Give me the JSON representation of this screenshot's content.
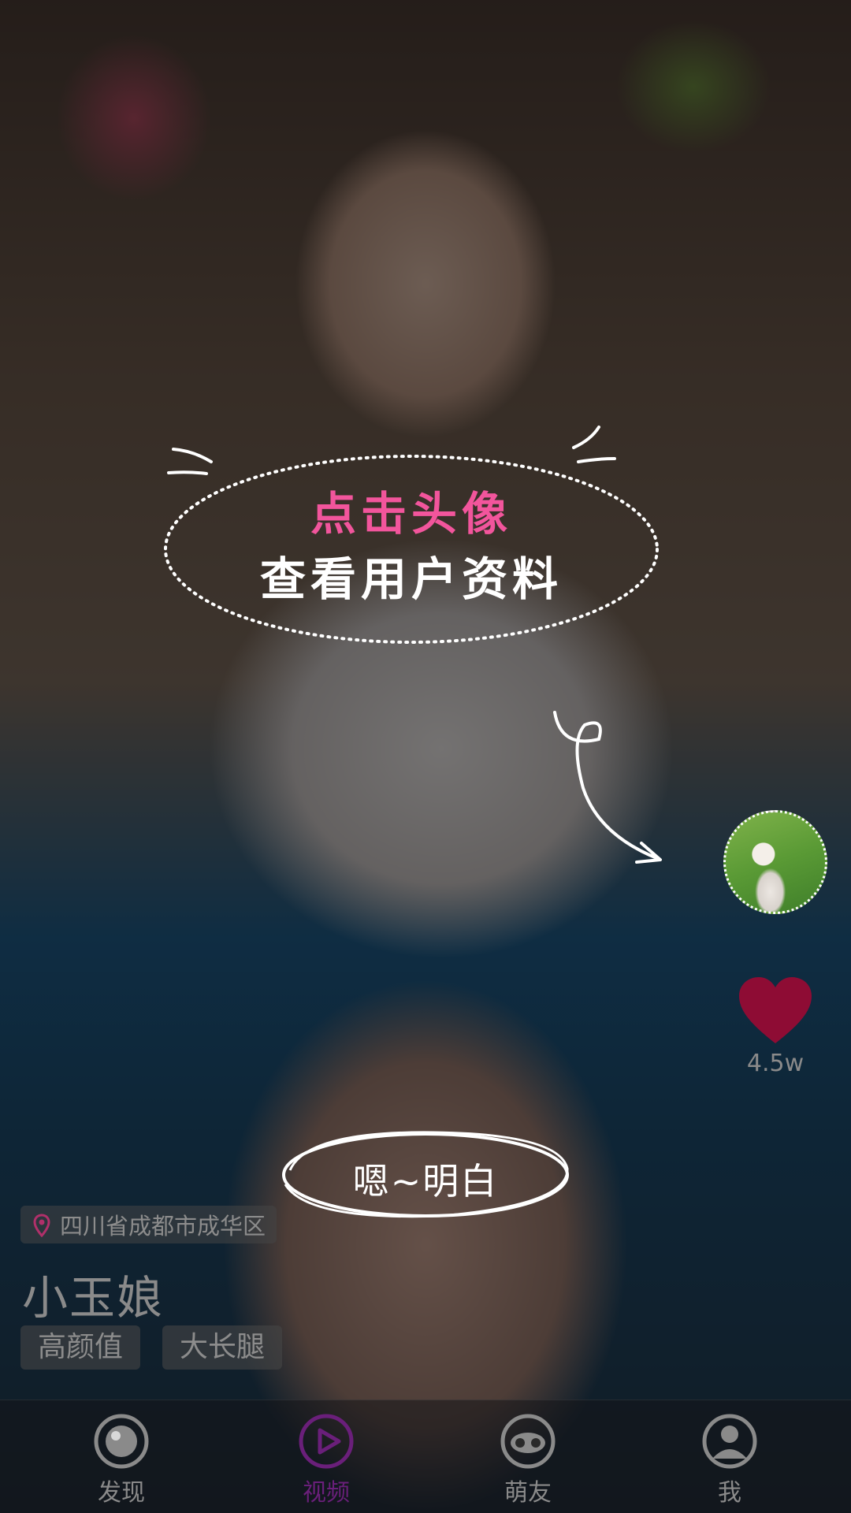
{
  "hint": {
    "title": "点击头像",
    "subtitle": "查看用户资料"
  },
  "like": {
    "count": "4.5w",
    "icon": "heart-icon",
    "color": "#8e0c34"
  },
  "confirm": {
    "label": "嗯~明白"
  },
  "profile": {
    "location": "四川省成都市成华区",
    "name": "小玉娘",
    "tags": [
      "高颜值",
      "大长腿"
    ]
  },
  "nav": {
    "items": [
      {
        "label": "发现",
        "icon": "discover-icon",
        "active": false
      },
      {
        "label": "视频",
        "icon": "video-play-icon",
        "active": true
      },
      {
        "label": "萌友",
        "icon": "friends-icon",
        "active": false
      },
      {
        "label": "我",
        "icon": "user-icon",
        "active": false
      }
    ],
    "active_color": "#6a1f7a",
    "inactive_color": "#8a8a8a"
  },
  "colors": {
    "accent_pink": "#f2559c"
  }
}
